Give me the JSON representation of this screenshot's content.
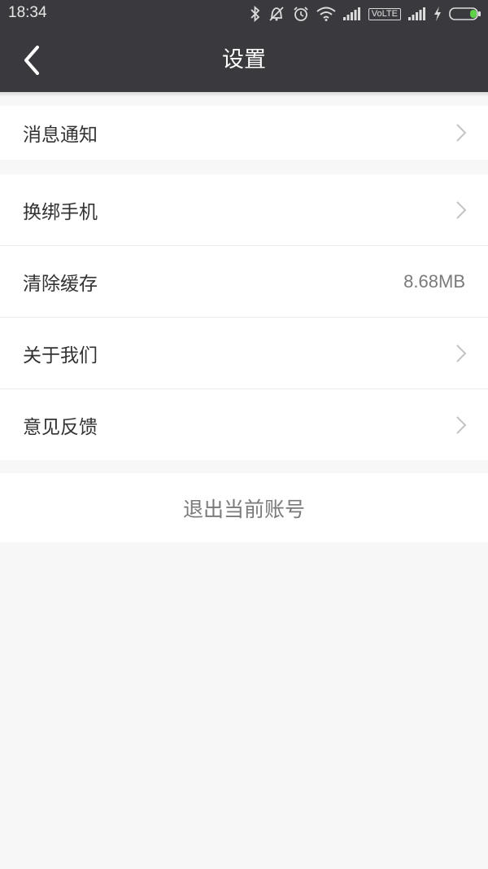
{
  "status_bar": {
    "time": "18:34",
    "network_label": "VoLTE",
    "icons": [
      "bluetooth-icon",
      "mute-icon",
      "alarm-icon",
      "wifi-icon",
      "signal-icon",
      "signal-icon",
      "charging-icon",
      "battery-icon"
    ],
    "battery_color": "#5ed34a"
  },
  "nav": {
    "title": "设置",
    "back_icon": "chevron-left-icon"
  },
  "settings": {
    "notifications": {
      "label": "消息通知"
    },
    "change_phone": {
      "label": "换绑手机"
    },
    "clear_cache": {
      "label": "清除缓存",
      "value": "8.68MB"
    },
    "about_us": {
      "label": "关于我们"
    },
    "feedback": {
      "label": "意见反馈"
    }
  },
  "logout": {
    "label": "退出当前账号"
  },
  "colors": {
    "header_bg": "#3a393d",
    "page_bg": "#f7f7f7"
  }
}
